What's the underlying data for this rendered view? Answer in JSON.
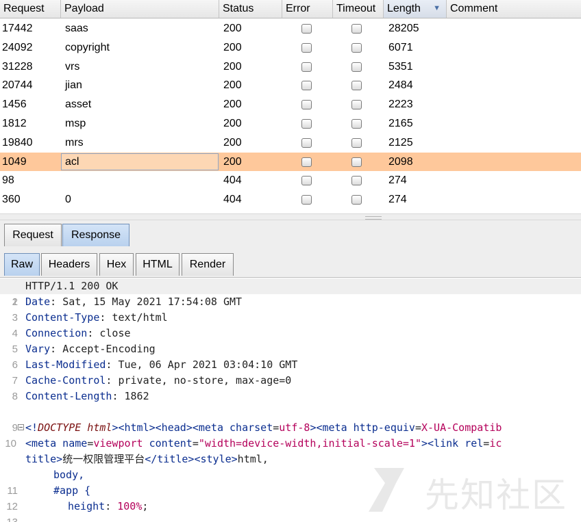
{
  "table": {
    "headers": {
      "request": "Request",
      "payload": "Payload",
      "status": "Status",
      "error": "Error",
      "timeout": "Timeout",
      "length": "Length",
      "comment": "Comment"
    },
    "sort": {
      "column": "length",
      "direction": "descending"
    },
    "rows": [
      {
        "request": "17442",
        "payload": "saas",
        "status": "200",
        "error": false,
        "timeout": false,
        "length": "28205"
      },
      {
        "request": "24092",
        "payload": "copyright",
        "status": "200",
        "error": false,
        "timeout": false,
        "length": "6071"
      },
      {
        "request": "31228",
        "payload": "vrs",
        "status": "200",
        "error": false,
        "timeout": false,
        "length": "5351"
      },
      {
        "request": "20744",
        "payload": "jian",
        "status": "200",
        "error": false,
        "timeout": false,
        "length": "2484"
      },
      {
        "request": "1456",
        "payload": "asset",
        "status": "200",
        "error": false,
        "timeout": false,
        "length": "2223"
      },
      {
        "request": "1812",
        "payload": "msp",
        "status": "200",
        "error": false,
        "timeout": false,
        "length": "2165"
      },
      {
        "request": "19840",
        "payload": "mrs",
        "status": "200",
        "error": false,
        "timeout": false,
        "length": "2125"
      },
      {
        "request": "1049",
        "payload": "acl",
        "status": "200",
        "error": false,
        "timeout": false,
        "length": "2098"
      },
      {
        "request": "98",
        "payload": "",
        "status": "404",
        "error": false,
        "timeout": false,
        "length": "274"
      },
      {
        "request": "360",
        "payload": "0",
        "status": "404",
        "error": false,
        "timeout": false,
        "length": "274"
      }
    ],
    "selected_row": 7,
    "selected_color": "#fec89b"
  },
  "tabs_top": {
    "request": "Request",
    "response": "Response",
    "active": "response"
  },
  "tabs_view": {
    "raw": "Raw",
    "headers": "Headers",
    "hex": "Hex",
    "html": "HTML",
    "render": "Render",
    "active": "raw"
  },
  "editor": {
    "line_numbers": [
      "1",
      "2",
      "3",
      "4",
      "5",
      "6",
      "7",
      "8",
      "9",
      "10",
      "",
      "",
      "11",
      "12",
      "13"
    ],
    "status_line": "HTTP/1.1 200 OK",
    "headers": [
      {
        "name": "Date",
        "value": "Sat, 15 May 2021 17:54:08 GMT"
      },
      {
        "name": "Content-Type",
        "value": "text/html"
      },
      {
        "name": "Connection",
        "value": "close"
      },
      {
        "name": "Vary",
        "value": "Accept-Encoding"
      },
      {
        "name": "Last-Modified",
        "value": "Tue, 06 Apr 2021 03:04:10 GMT"
      },
      {
        "name": "Cache-Control",
        "value": "private, no-store, max-age=0"
      },
      {
        "name": "Content-Length",
        "value": "1862"
      }
    ],
    "body_lines": [
      "<!DOCTYPE html><html><head><meta charset=utf-8><meta http-equiv=X-UA-Compatib",
      "<meta name=viewport content=\"width=device-width,initial-scale=1\"><link rel=ic",
      "title>统一权限管理平台</title><style>html,",
      "body,",
      "#app {",
      "height: 100%;"
    ]
  },
  "watermark": "先知社区",
  "colors": {
    "keyword": "#0a2d8f",
    "string": "#b4005a",
    "doctype": "#7a1010"
  }
}
